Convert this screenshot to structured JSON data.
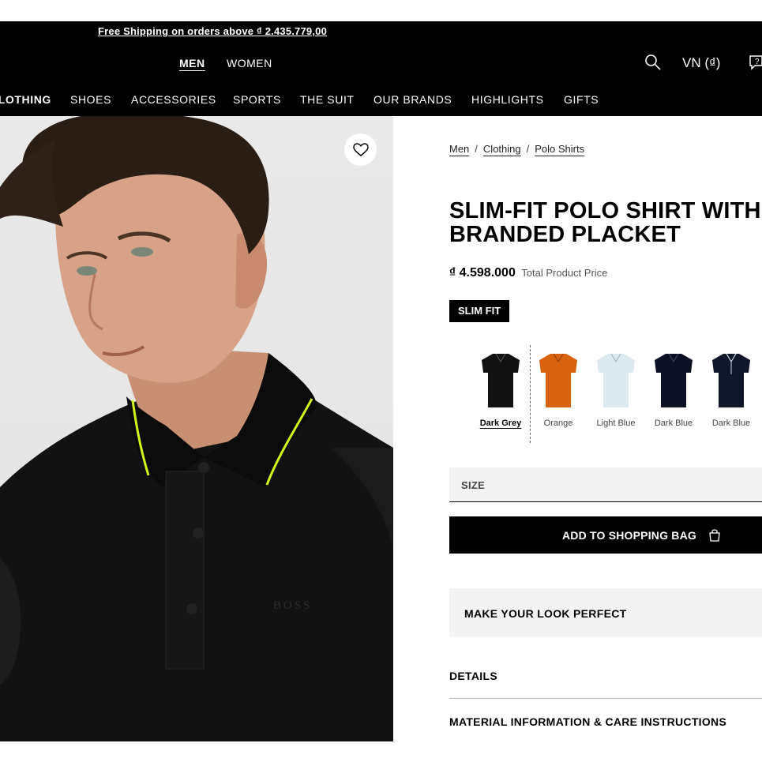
{
  "header": {
    "promo": "Free Shipping on orders above ₫ 2.435.779,00",
    "gender_tabs": [
      {
        "label": "MEN",
        "active": true
      },
      {
        "label": "WOMEN",
        "active": false
      }
    ],
    "search_icon": "search-icon",
    "locale": "VN (₫)",
    "chat_icon": "chat-icon"
  },
  "category_nav": [
    {
      "label": "CLOTHING",
      "active": true
    },
    {
      "label": "SHOES"
    },
    {
      "label": "ACCESSORIES"
    },
    {
      "label": "SPORTS"
    },
    {
      "label": "THE SUIT"
    },
    {
      "label": "OUR BRANDS"
    },
    {
      "label": "HIGHLIGHTS"
    },
    {
      "label": "GIFTS"
    }
  ],
  "product": {
    "breadcrumb": [
      "Men",
      "Clothing",
      "Polo Shirts"
    ],
    "title": "SLIM-FIT POLO SHIRT WITH BRANDED PLACKET",
    "price": "₫ 4.598.000",
    "price_label": "Total Product Price",
    "fit_badge": "SLIM FIT",
    "image_logo_text": "BOSS",
    "colors": [
      {
        "name": "Dark Grey",
        "hex": "#111111",
        "selected": true
      },
      {
        "name": "Orange",
        "hex": "#d9620e",
        "selected": false
      },
      {
        "name": "Light Blue",
        "hex": "#dce9ee",
        "selected": false
      },
      {
        "name": "Dark Blue",
        "hex": "#0c1224",
        "selected": false
      },
      {
        "name": "Dark Blue",
        "hex": "#10172a",
        "selected": false
      }
    ],
    "size_label": "SIZE",
    "add_to_bag": "ADD TO SHOPPING BAG",
    "look_section": "MAKE YOUR LOOK PERFECT",
    "accordions": [
      "DETAILS",
      "MATERIAL INFORMATION & CARE INSTRUCTIONS"
    ]
  },
  "colors": {
    "header_bg": "#000000",
    "accent_tipping": "#d4f51c",
    "panel_bg": "#f3f3f3"
  }
}
